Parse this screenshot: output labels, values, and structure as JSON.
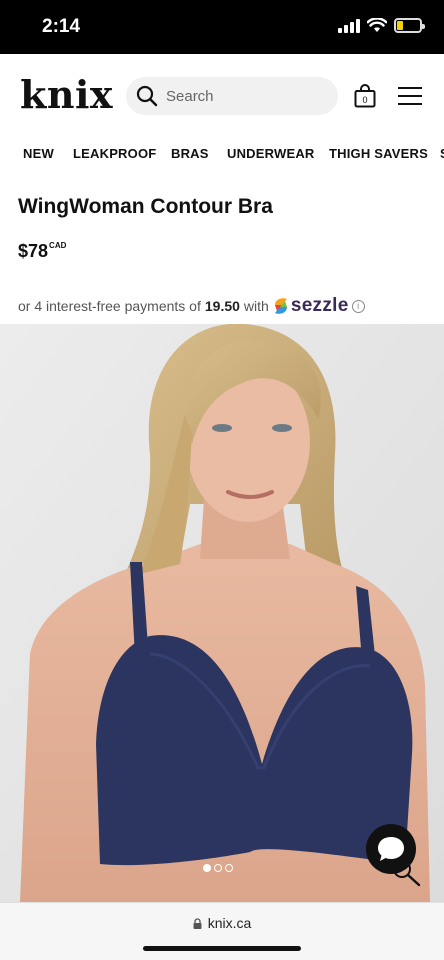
{
  "status_bar": {
    "time": "2:14",
    "battery_level": 0.25,
    "battery_color": "#f5d20a"
  },
  "header": {
    "logo": "knix",
    "search_placeholder": "Search",
    "cart_count": "0",
    "icons": [
      "search-icon",
      "shopping-bag-icon",
      "hamburger-menu-icon"
    ]
  },
  "nav": {
    "items": [
      "NEW",
      "LEAKPROOF",
      "BRAS",
      "UNDERWEAR",
      "THIGH SAVERS",
      "S"
    ]
  },
  "product": {
    "title": "WingWoman Contour Bra",
    "price": "$78",
    "currency": "CAD",
    "installments_prefix": "or 4 interest-free payments of",
    "installments_amount": "19.50",
    "installments_suffix": "with",
    "provider": "sezzle",
    "carousel_current": 1,
    "carousel_total": 3,
    "bra_color": "#2c3560"
  },
  "browser": {
    "url": "knix.ca"
  }
}
